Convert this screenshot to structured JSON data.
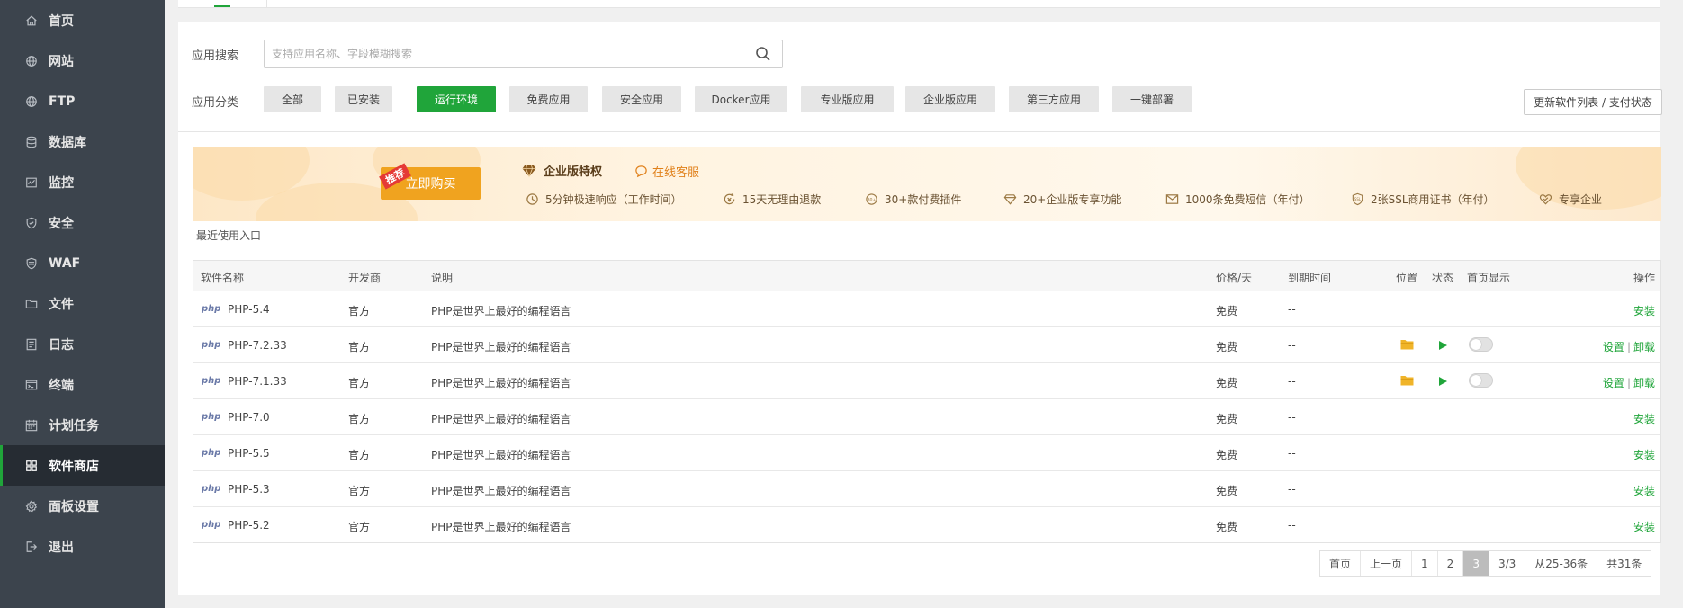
{
  "sidebar": {
    "items": [
      {
        "label": "首页",
        "icon": "home-icon"
      },
      {
        "label": "网站",
        "icon": "globe-icon"
      },
      {
        "label": "FTP",
        "icon": "globe-icon"
      },
      {
        "label": "数据库",
        "icon": "database-icon"
      },
      {
        "label": "监控",
        "icon": "monitor-icon"
      },
      {
        "label": "安全",
        "icon": "shield-icon"
      },
      {
        "label": "WAF",
        "icon": "waf-icon"
      },
      {
        "label": "文件",
        "icon": "folder-icon"
      },
      {
        "label": "日志",
        "icon": "log-icon"
      },
      {
        "label": "终端",
        "icon": "terminal-icon"
      },
      {
        "label": "计划任务",
        "icon": "calendar-icon"
      },
      {
        "label": "软件商店",
        "icon": "grid-icon",
        "active": true
      },
      {
        "label": "面板设置",
        "icon": "gear-icon"
      },
      {
        "label": "退出",
        "icon": "logout-icon"
      }
    ]
  },
  "search": {
    "label": "应用搜索",
    "placeholder": "支持应用名称、字段模糊搜索",
    "value": ""
  },
  "categories": {
    "label": "应用分类",
    "items": [
      "全部",
      "已安装",
      "运行环境",
      "免费应用",
      "安全应用",
      "Docker应用",
      "专业版应用",
      "企业版应用",
      "第三方应用",
      "一键部署"
    ],
    "active_index": 2
  },
  "update_button": "更新软件列表 / 支付状态",
  "banner": {
    "badge": "推荐",
    "buy_button": "立即购买",
    "title": "企业版特权",
    "service": "在线客服",
    "features": [
      "5分钟极速响应（工作时间）",
      "15天无理由退款",
      "30+款付费插件",
      "20+企业版专享功能",
      "1000条免费短信（年付）",
      "2张SSL商用证书（年付）",
      "专享企业"
    ]
  },
  "recent_label": "最近使用入口",
  "table": {
    "headers": {
      "name": "软件名称",
      "developer": "开发商",
      "desc": "说明",
      "price": "价格/天",
      "expire": "到期时间",
      "position": "位置",
      "status": "状态",
      "home_display": "首页显示",
      "actions": "操作"
    },
    "rows": [
      {
        "logo": "php",
        "name": "PHP-5.4",
        "developer": "官方",
        "desc": "PHP是世界上最好的编程语言",
        "price": "免费",
        "expire": "--",
        "installed": false,
        "action": "安装"
      },
      {
        "logo": "php",
        "name": "PHP-7.2.33",
        "developer": "官方",
        "desc": "PHP是世界上最好的编程语言",
        "price": "免费",
        "expire": "--",
        "installed": true,
        "action": "设置",
        "action2": "卸载",
        "separator": "|"
      },
      {
        "logo": "php",
        "name": "PHP-7.1.33",
        "developer": "官方",
        "desc": "PHP是世界上最好的编程语言",
        "price": "免费",
        "expire": "--",
        "installed": true,
        "action": "设置",
        "action2": "卸载",
        "separator": "|"
      },
      {
        "logo": "php",
        "name": "PHP-7.0",
        "developer": "官方",
        "desc": "PHP是世界上最好的编程语言",
        "price": "免费",
        "expire": "--",
        "installed": false,
        "action": "安装"
      },
      {
        "logo": "php",
        "name": "PHP-5.5",
        "developer": "官方",
        "desc": "PHP是世界上最好的编程语言",
        "price": "免费",
        "expire": "--",
        "installed": false,
        "action": "安装"
      },
      {
        "logo": "php",
        "name": "PHP-5.3",
        "developer": "官方",
        "desc": "PHP是世界上最好的编程语言",
        "price": "免费",
        "expire": "--",
        "installed": false,
        "action": "安装"
      },
      {
        "logo": "php",
        "name": "PHP-5.2",
        "developer": "官方",
        "desc": "PHP是世界上最好的编程语言",
        "price": "免费",
        "expire": "--",
        "installed": false,
        "action": "安装"
      }
    ]
  },
  "pagination": {
    "first": "首页",
    "prev": "上一页",
    "pages": [
      "1",
      "2",
      "3"
    ],
    "current": "3",
    "page_of": "3/3",
    "range": "从25-36条",
    "total": "共31条"
  },
  "colors": {
    "accent": "#20a53a",
    "sidebar_bg": "#3c444d",
    "sidebar_active_bg": "#262c33",
    "buy_button": "#f0a31f",
    "badge": "#e53935"
  }
}
